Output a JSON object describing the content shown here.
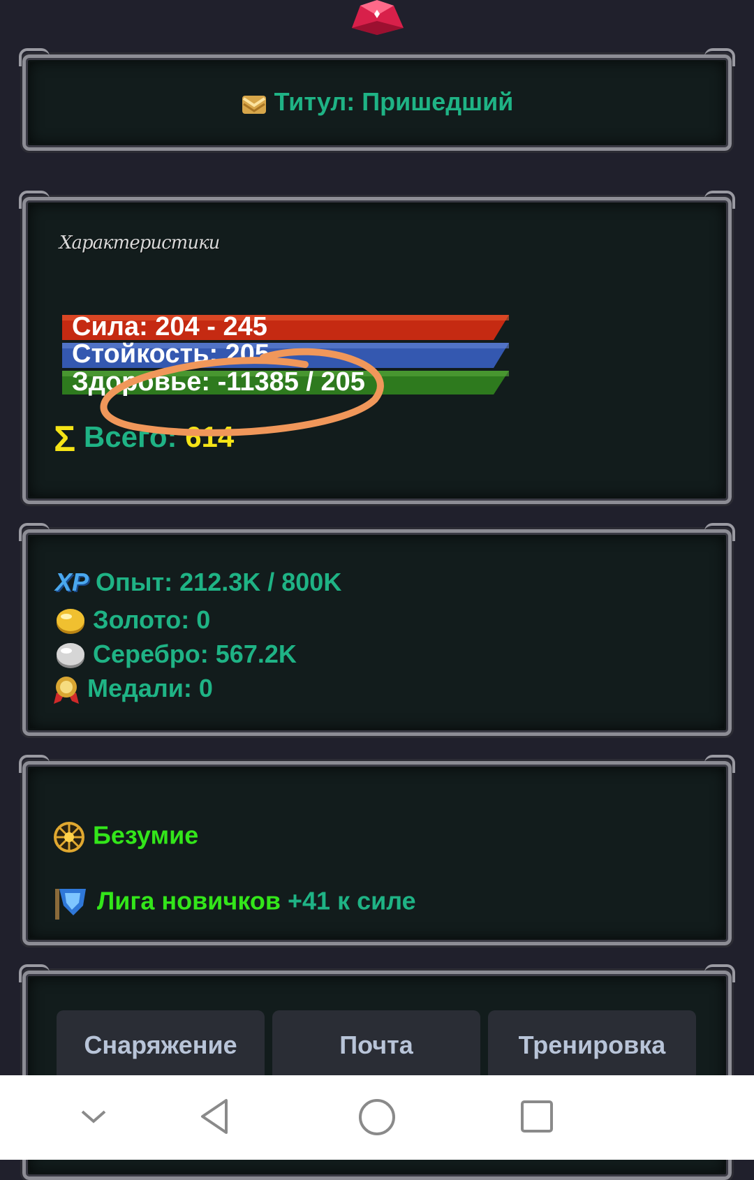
{
  "title": {
    "text": "Титул: Пришедший"
  },
  "stats": {
    "heading": "Характеристики",
    "strength": "Сила: 204 - 245",
    "stamina": "Стойкость: 205",
    "health": "Здоровье: -11385 / 205",
    "total_label": "Всего:",
    "total_value": "614"
  },
  "resources": {
    "xp": "Опыт: 212.3K / 800K",
    "gold": "Золото: 0",
    "silver": "Серебро: 567.2K",
    "medals": "Медали: 0",
    "xp_badge": "XP"
  },
  "status": {
    "madness": "Безумие",
    "league": "Лига новичков",
    "league_bonus": "+41 к силе"
  },
  "buttons": {
    "equipment": "Снаряжение",
    "mail": "Почта",
    "training": "Тренировка"
  },
  "colors": {
    "bar_red": "#c52a12",
    "bar_blue": "#3458b0",
    "bar_green": "#2e7a1e",
    "teal_text": "#1fb385",
    "yellow": "#f5e416",
    "lime": "#33e61a",
    "annotation": "#f0975a"
  }
}
